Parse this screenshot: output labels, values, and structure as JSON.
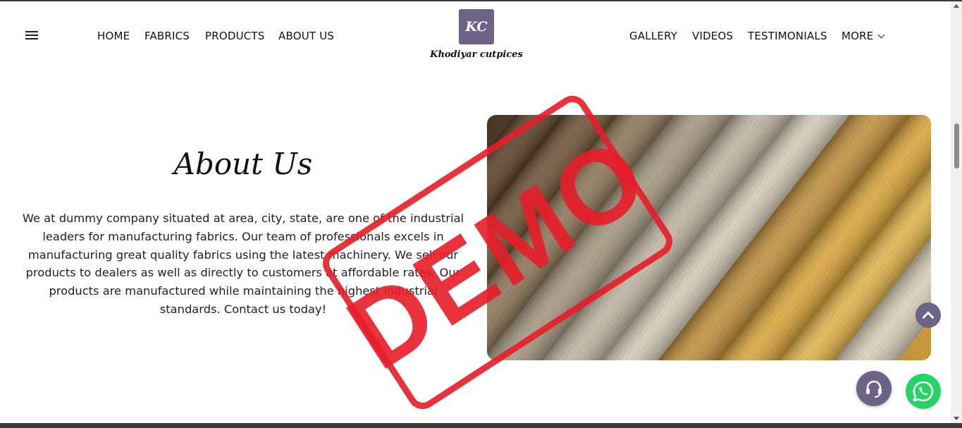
{
  "nav": {
    "left": [
      "HOME",
      "FABRICS",
      "PRODUCTS",
      "ABOUT US"
    ],
    "right": [
      "GALLERY",
      "VIDEOS",
      "TESTIMONIALS",
      "MORE"
    ]
  },
  "brand": {
    "initials": "KC",
    "name": "Khodiyar cutpices",
    "color": "#6b6487"
  },
  "about": {
    "title": "About Us",
    "body": "We at dummy company situated at area, city, state, are one of the industrial leaders for manufacturing fabrics. Our team of professionals excels in manufacturing great quality fabrics using the latest machinery. We sell our products to dealers as well as directly to customers at affordable rates. Our products are manufactured while maintaining the highest industrial standards. Contact us today!"
  },
  "watermark": {
    "text": "DEMO",
    "color": "#e81c28"
  },
  "floating": {
    "scroll_top_icon": "chevron-up-icon",
    "support_icon": "headset-icon",
    "whatsapp_icon": "whatsapp-icon",
    "whatsapp_color": "#25d366"
  }
}
